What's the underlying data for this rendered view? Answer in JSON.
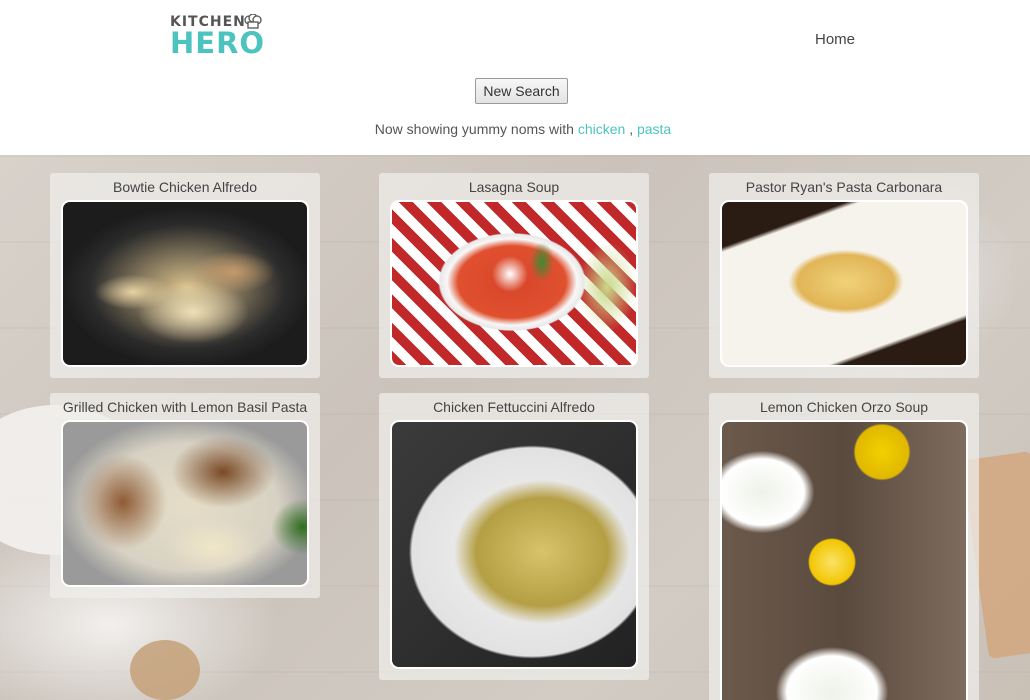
{
  "header": {
    "logo_top": "KITCHEN",
    "logo_bottom": "HERO",
    "nav_home": "Home"
  },
  "search": {
    "new_search_label": "New Search",
    "showing_prefix": "Now showing yummy noms with",
    "tags": [
      "chicken",
      "pasta"
    ],
    "tag_separator": ","
  },
  "recipes": [
    {
      "title": "Bowtie Chicken Alfredo"
    },
    {
      "title": "Lasagna Soup"
    },
    {
      "title": "Pastor Ryan's Pasta Carbonara"
    },
    {
      "title": "Grilled Chicken with Lemon Basil Pasta"
    },
    {
      "title": "Chicken Fettuccini Alfredo"
    },
    {
      "title": "Lemon Chicken Orzo Soup"
    }
  ],
  "colors": {
    "accent": "#4dc3c0",
    "text": "#444444"
  }
}
